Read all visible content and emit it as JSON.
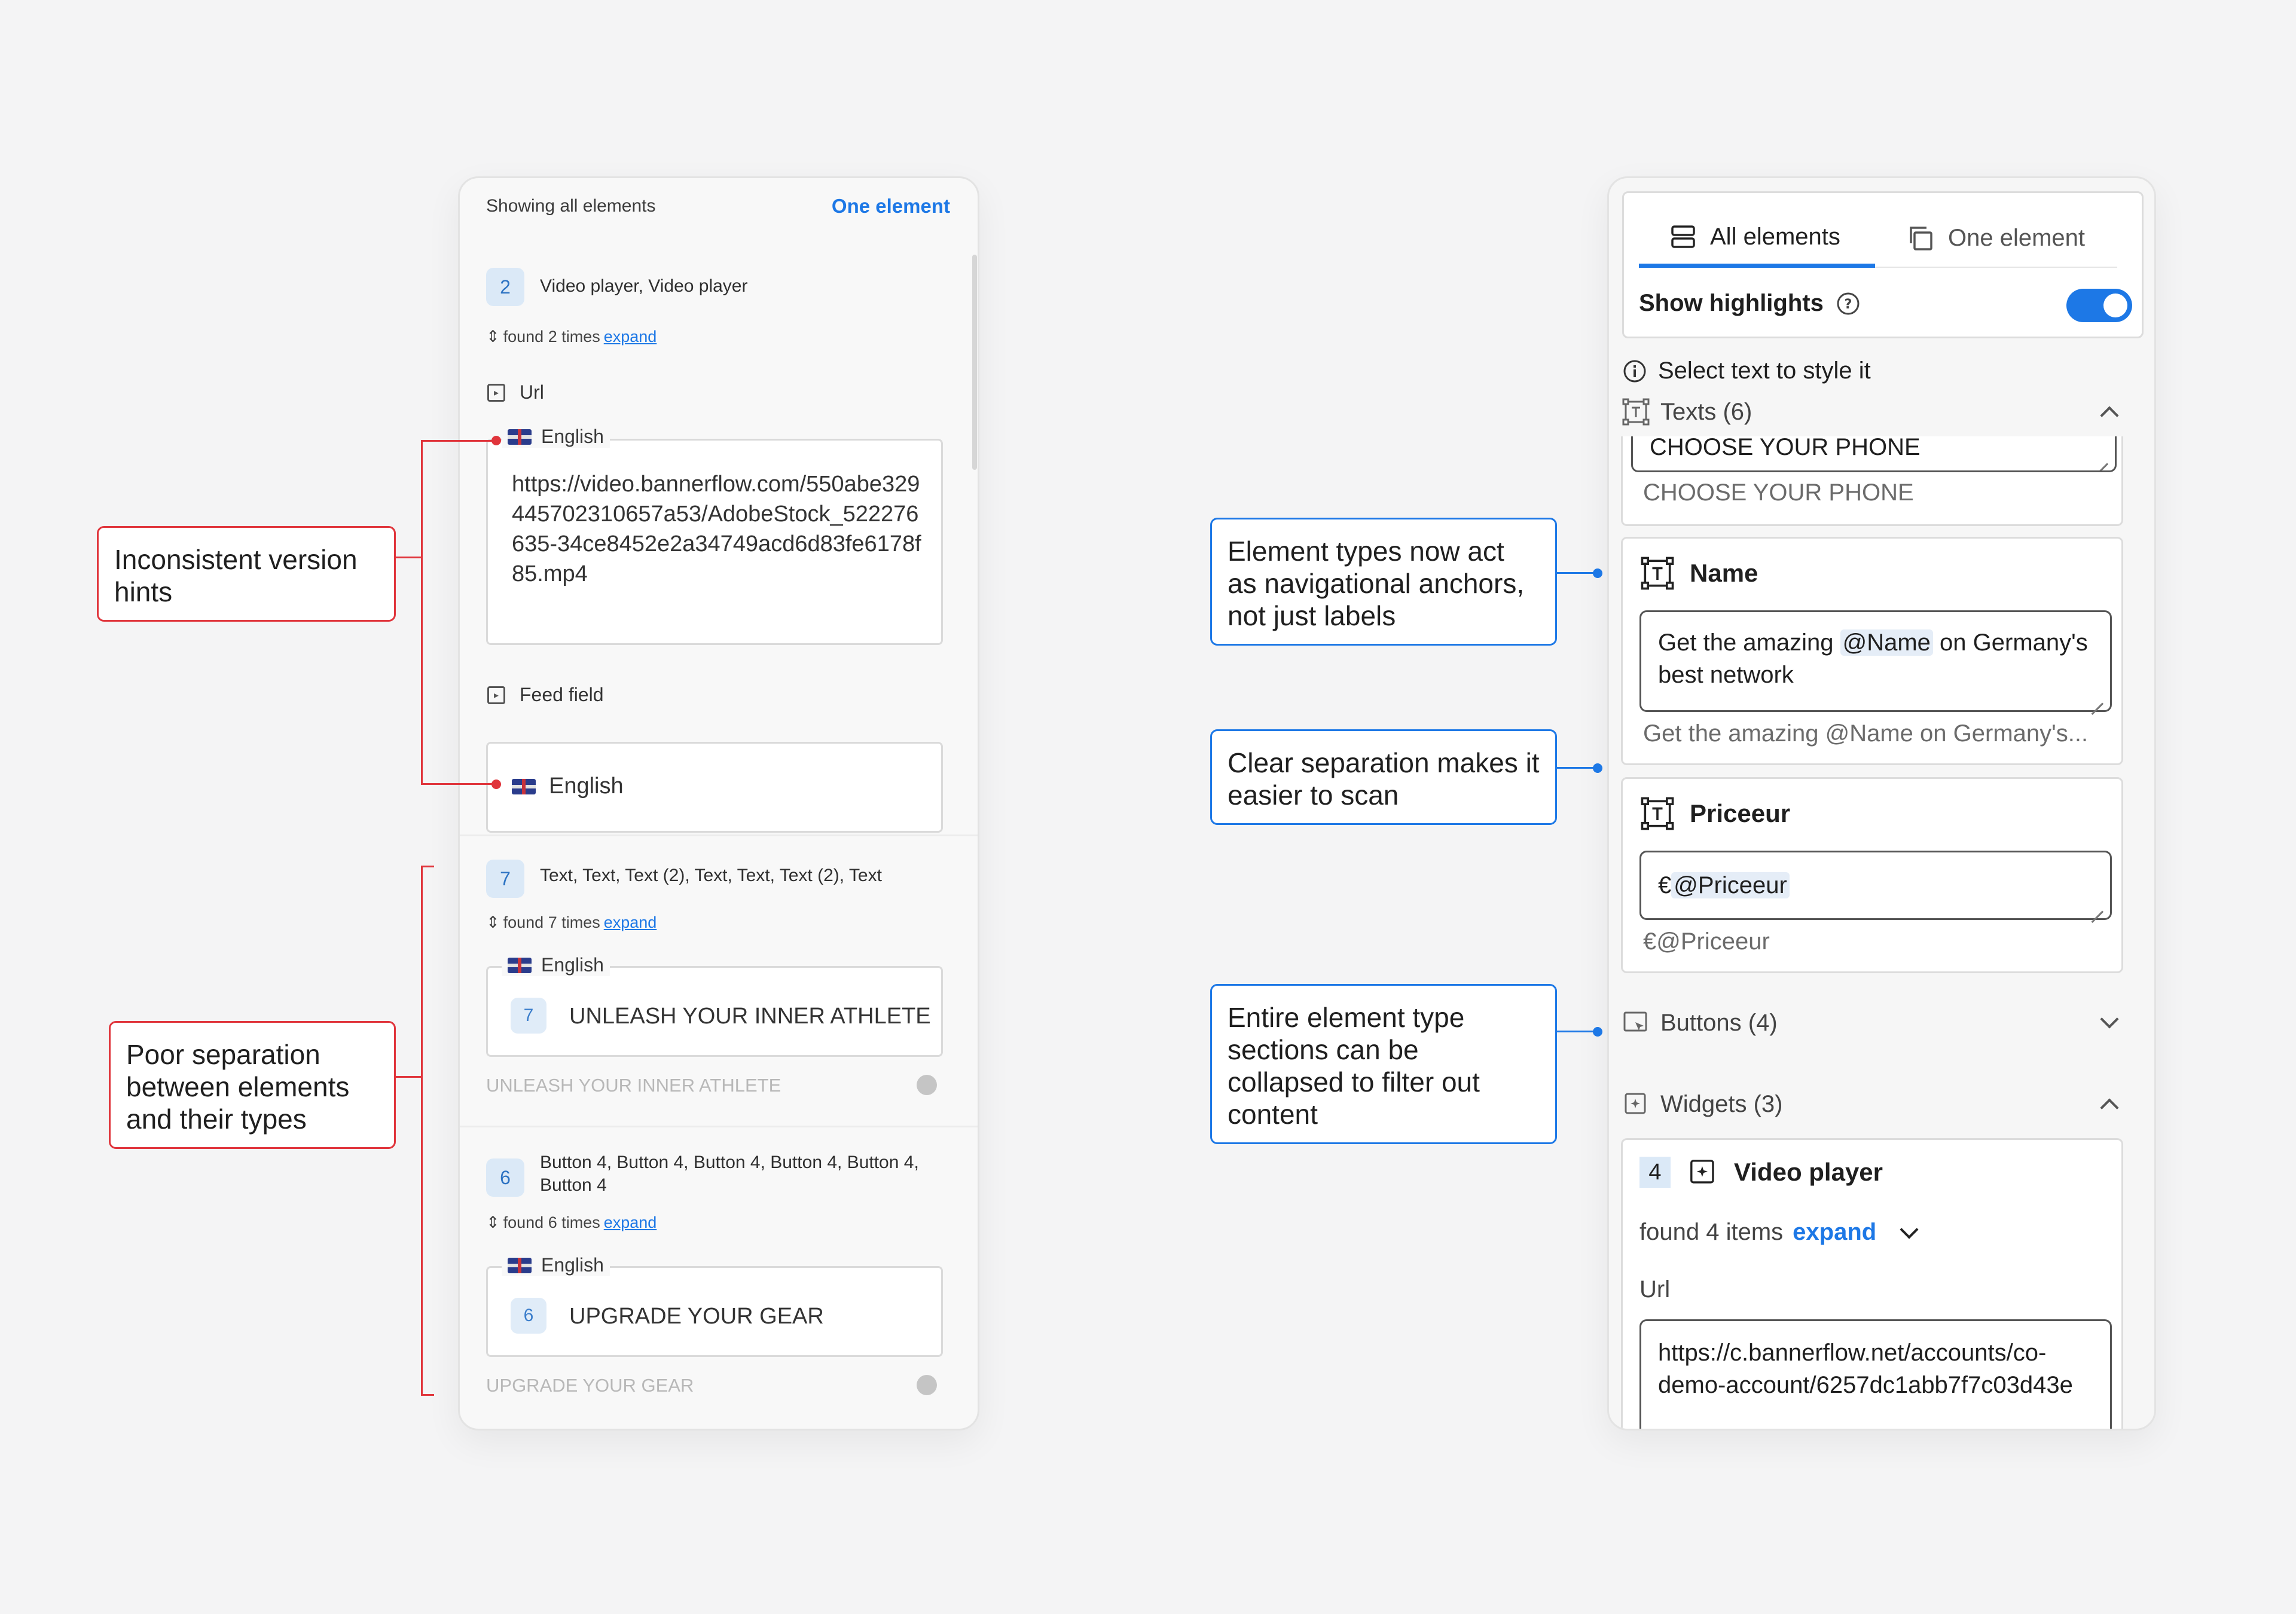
{
  "old_panel": {
    "header_left": "Showing all elements",
    "header_right": "One element",
    "group1": {
      "count": "2",
      "title": "Video player, Video player",
      "found": "found 2 times",
      "expand": "expand",
      "url_label": "Url",
      "language": "English",
      "url_value": "https://video.bannerflow.com/550abe329445702310657a53/AdobeStock_522276635-34ce8452e2a34749acd6d83fe6178f85.mp4",
      "feed_label": "Feed field",
      "feed_language": "English"
    },
    "group2": {
      "count": "7",
      "title": "Text, Text, Text (2), Text, Text, Text (2), Text",
      "found": "found 7 times",
      "expand": "expand",
      "language": "English",
      "mini": "7",
      "value": "UNLEASH YOUR INNER ATHLETE",
      "preview": "UNLEASH YOUR INNER ATHLETE"
    },
    "group3": {
      "count": "6",
      "title": "Button 4, Button 4, Button 4, Button 4, Button 4, Button 4",
      "found": "found 6 times",
      "expand": "expand",
      "language": "English",
      "mini": "6",
      "value": "UPGRADE YOUR GEAR",
      "preview": "UPGRADE YOUR GEAR"
    }
  },
  "new_panel": {
    "tab_all": "All elements",
    "tab_one": "One element",
    "show_highlights": "Show highlights",
    "highlights_on": true,
    "select_hint": "Select text to style it",
    "texts_section": "Texts (6)",
    "cut_input": "CHOOSE YOUR PHONE",
    "cut_preview": "CHOOSE YOUR PHONE",
    "name_card": {
      "title": "Name",
      "input_pre": "Get the amazing ",
      "input_highlight": "@Name",
      "input_post": " on Germany's best network",
      "preview": "Get the amazing @Name on Germany's..."
    },
    "price_card": {
      "title": "Priceeur",
      "input_pre": "€",
      "input_highlight": "@Priceeur",
      "preview": "€@Priceeur"
    },
    "buttons_section": "Buttons (4)",
    "widgets_section": "Widgets (3)",
    "video_card": {
      "count": "4",
      "title": "Video player",
      "found": "found 4 items",
      "expand": "expand",
      "url_label": "Url",
      "url_value": "https://c.bannerflow.net/accounts/co-demo-account/6257dc1abb7f7c03d43e"
    }
  },
  "callouts": {
    "inconsistent": "Inconsistent version hints",
    "poor_separation": "Poor separation between elements and their types",
    "anchors": "Element types now act as navigational anchors, not just labels",
    "clear_separation": "Clear separation makes it easier to scan",
    "collapse": "Entire element type sections can be collapsed to filter out content"
  },
  "colors": {
    "accent_blue": "#1d78e6",
    "accent_red": "#e0353c"
  }
}
